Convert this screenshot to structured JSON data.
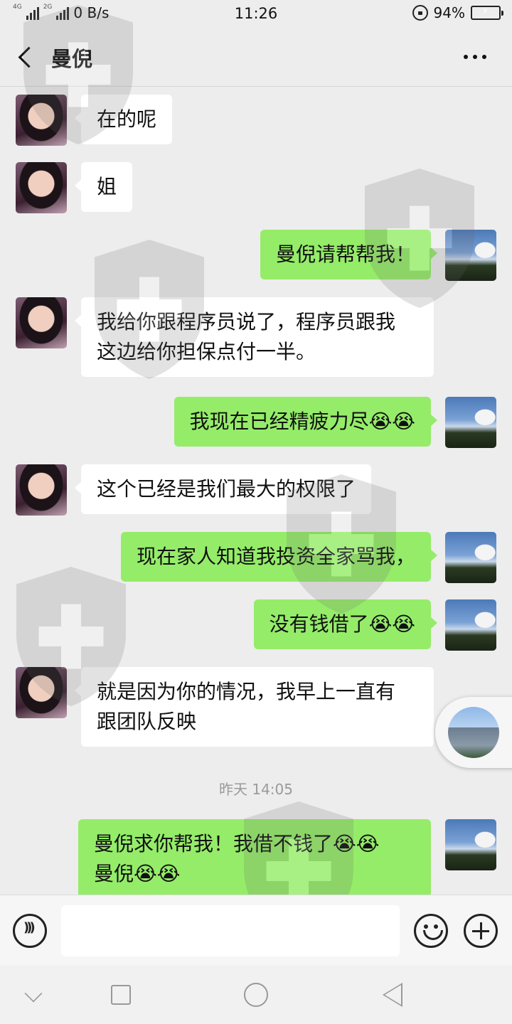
{
  "status_bar": {
    "network_tag_1": "4G",
    "network_tag_2": "2G",
    "speed": "0 B/s",
    "time": "11:26",
    "battery": "94%"
  },
  "header": {
    "title": "曼倪"
  },
  "messages": [
    {
      "side": "in",
      "text": "在的呢"
    },
    {
      "side": "in",
      "text": "姐"
    },
    {
      "side": "out",
      "text": "曼倪请帮帮我！"
    },
    {
      "side": "in",
      "line1": "我给你跟程序员说了，程序员跟我",
      "line2": "这边给你担保点付一半。"
    },
    {
      "side": "out",
      "text": "我现在已经精疲力尽😭😭"
    },
    {
      "side": "in",
      "text": "这个已经是我们最大的权限了"
    },
    {
      "side": "out",
      "text": "现在家人知道我投资全家骂我，"
    },
    {
      "side": "out",
      "text": "没有钱借了😭😭"
    },
    {
      "side": "in",
      "line1": "就是因为你的情况，我早上一直有",
      "line2": "跟团队反映"
    },
    {
      "side": "out",
      "line1": "曼倪求你帮我！我借不钱了😭😭",
      "line2": "曼倪😭😭"
    }
  ],
  "timestamp": "昨天 14:05",
  "input": {
    "value": ""
  },
  "colors": {
    "outgoing_bubble": "#95ec69",
    "incoming_bubble": "#ffffff",
    "background": "#ededed"
  }
}
